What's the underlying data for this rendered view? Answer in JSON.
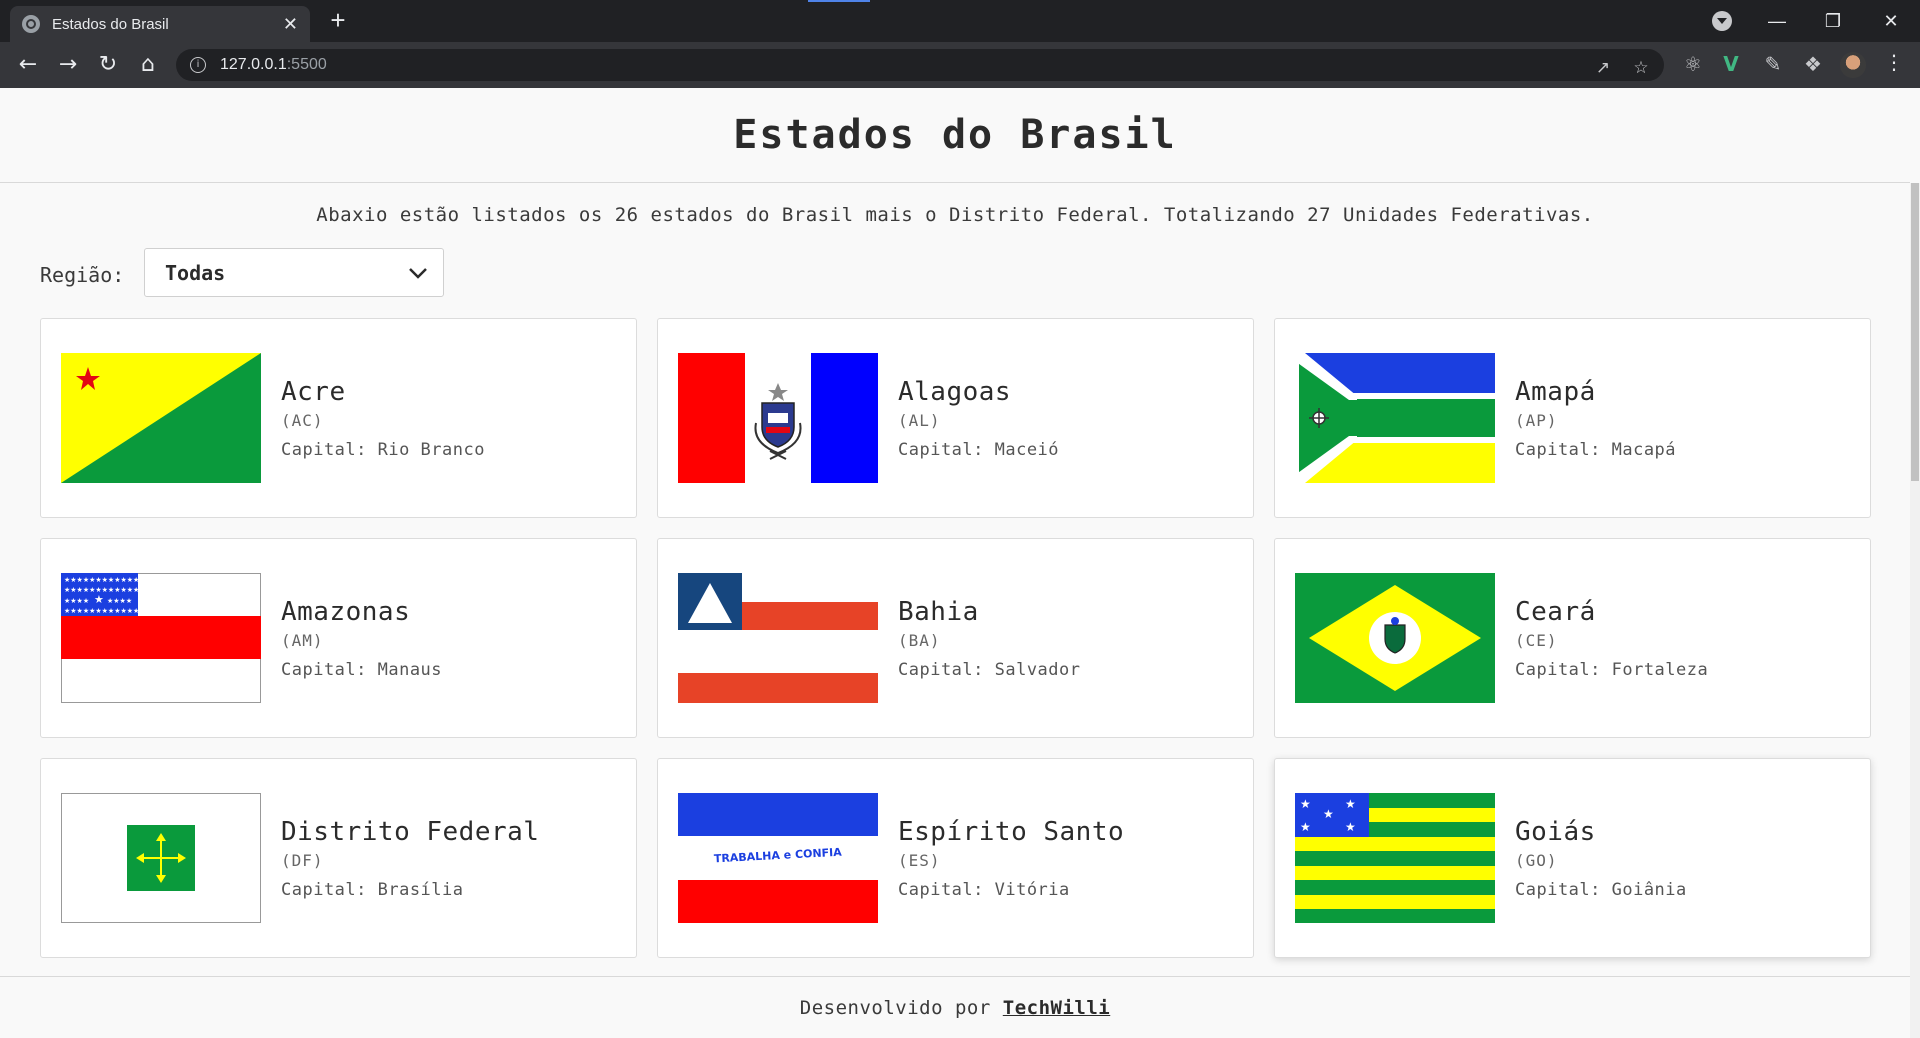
{
  "browser": {
    "tab_title": "Estados do Brasil",
    "tab_close": "✕",
    "new_tab": "+",
    "url_host": "127.0.0.1",
    "url_port": ":5500"
  },
  "page": {
    "title": "Estados do Brasil",
    "description": "Abaxio estão listados os 26 estados do Brasil mais o Distrito Federal. Totalizando 27 Unidades Federativas.",
    "region_label": "Região:",
    "region_selected": "Todas",
    "capital_prefix": "Capital:",
    "footer_text": "Desenvolvido por",
    "footer_link": "TechWilli"
  },
  "states": [
    {
      "name": "Acre",
      "abbr": "(AC)",
      "capital": "Capital: Rio Branco",
      "flag": "acre-flag"
    },
    {
      "name": "Alagoas",
      "abbr": "(AL)",
      "capital": "Capital: Maceió",
      "flag": "alagoas-flag"
    },
    {
      "name": "Amapá",
      "abbr": "(AP)",
      "capital": "Capital: Macapá",
      "flag": "amapa-flag"
    },
    {
      "name": "Amazonas",
      "abbr": "(AM)",
      "capital": "Capital: Manaus",
      "flag": "amazonas-flag"
    },
    {
      "name": "Bahia",
      "abbr": "(BA)",
      "capital": "Capital: Salvador",
      "flag": "bahia-flag"
    },
    {
      "name": "Ceará",
      "abbr": "(CE)",
      "capital": "Capital: Fortaleza",
      "flag": "ceara-flag"
    },
    {
      "name": "Distrito Federal",
      "abbr": "(DF)",
      "capital": "Capital: Brasília",
      "flag": "distrito-federal-flag"
    },
    {
      "name": "Espírito Santo",
      "abbr": "(ES)",
      "capital": "Capital: Vitória",
      "flag": "espirito-santo-flag",
      "motto": "TRABALHA e CONFIA"
    },
    {
      "name": "Goiás",
      "abbr": "(GO)",
      "capital": "Capital: Goiânia",
      "flag": "goias-flag"
    }
  ],
  "colors": {
    "chrome_dark": "#202124",
    "chrome_toolbar": "#35363a",
    "page_bg": "#f9f9f9",
    "text": "#2b2b2b"
  }
}
